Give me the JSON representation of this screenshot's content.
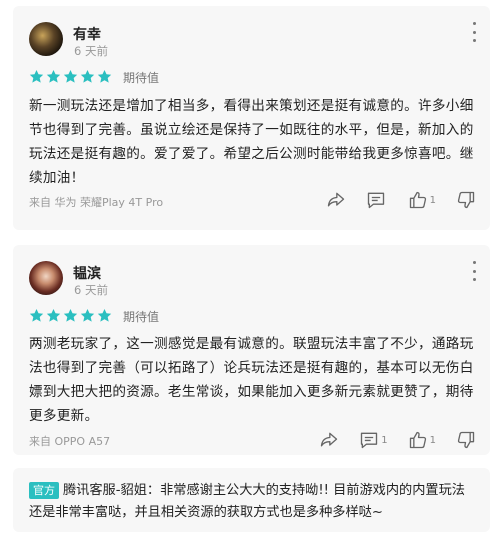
{
  "reviews": [
    {
      "username": "有幸",
      "date": "6 天前",
      "rating": 5,
      "rating_label": "期待值",
      "text": "新一测玩法还是增加了相当多，看得出来策划还是挺有诚意的。许多小细节也得到了完善。虽说立绘还是保持了一如既往的水平，但是，新加入的玩法还是挺有趣的。爱了爱了。希望之后公测时能带给我更多惊喜吧。继续加油！",
      "device": "来自 华为 荣耀Play 4T Pro",
      "comment_count": "",
      "like_count": "1"
    },
    {
      "username": "韫滨",
      "date": "6 天前",
      "rating": 5,
      "rating_label": "期待值",
      "text": "两测老玩家了，这一测感觉是最有诚意的。联盟玩法丰富了不少，通路玩法也得到了完善（可以拓路了）论兵玩法还是挺有趣的，基本可以无伤白嫖到大把大把的资源。老生常谈，如果能加入更多新元素就更赞了，期待更多更新。",
      "device": "来自 OPPO A57",
      "comment_count": "1",
      "like_count": "1"
    }
  ],
  "official_reply": {
    "badge": "官方",
    "text": "腾讯客服-貂姐：非常感谢主公大大的支持呦!! 目前游戏内的内置玩法还是非常丰富哒，并且相关资源的获取方式也是多种多样哒~"
  },
  "colors": {
    "star": "#2bbfc0",
    "badge": "#2bbfc0",
    "icon": "#666666"
  },
  "icons": [
    "more-dots-icon",
    "star-icon",
    "share-icon",
    "comment-icon",
    "thumbs-up-icon",
    "thumbs-down-icon"
  ]
}
